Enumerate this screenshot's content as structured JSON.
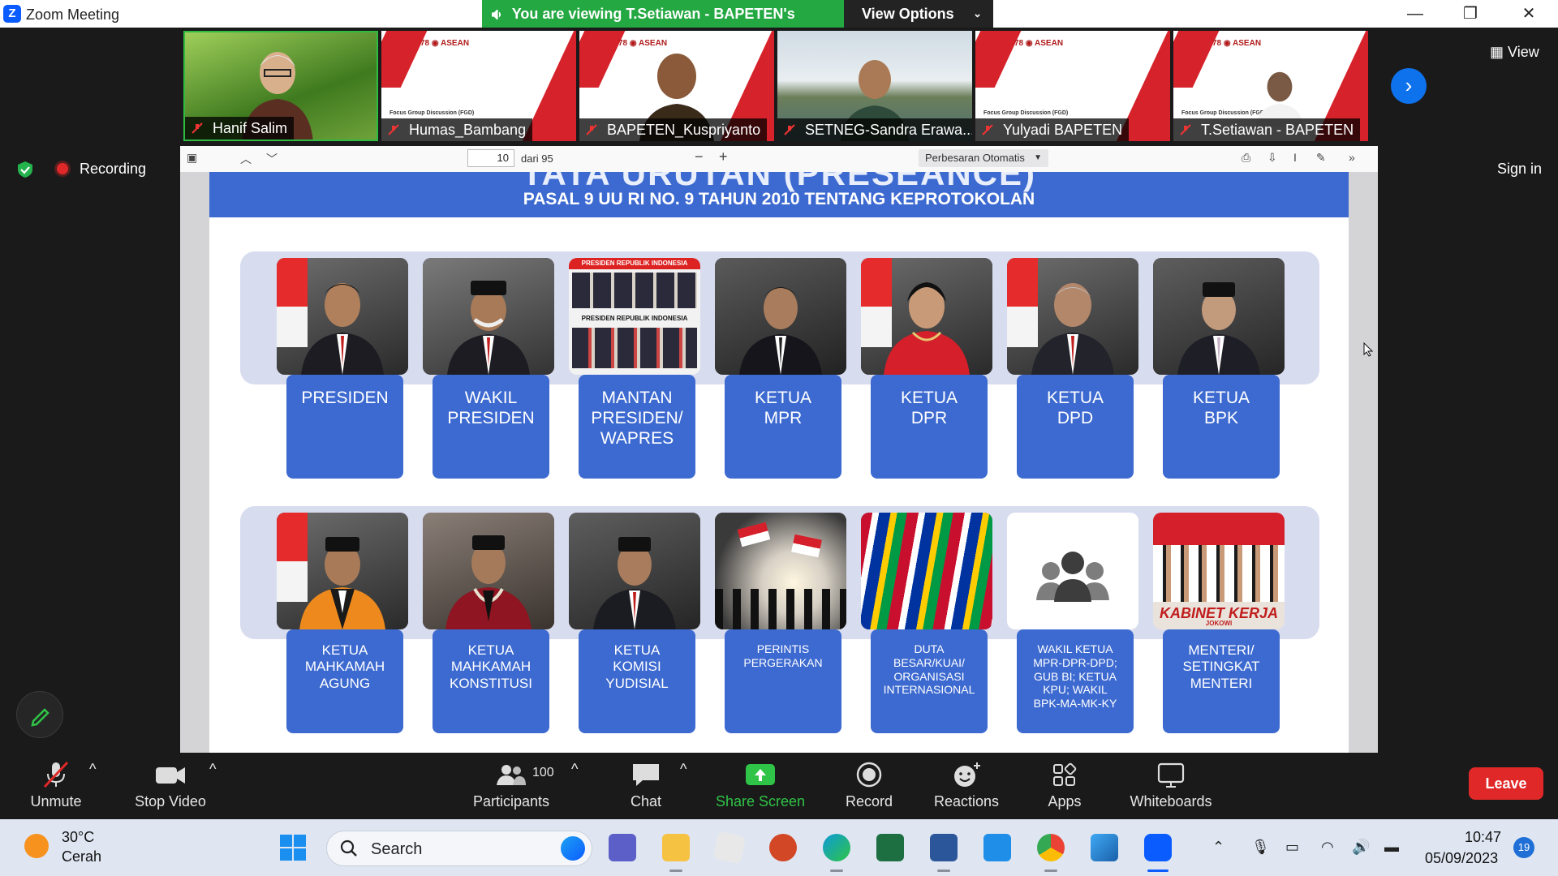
{
  "window": {
    "title": "Zoom Meeting",
    "share_banner": "You are viewing T.Setiawan - BAPETEN's screen",
    "view_options": "View Options",
    "minimize": "—",
    "restore": "❐",
    "close": "✕"
  },
  "meeting": {
    "participants_strip": [
      {
        "name": "Hanif Salim",
        "active": true
      },
      {
        "name": "Humas_Bambang"
      },
      {
        "name": "BAPETEN_Kuspriyanto"
      },
      {
        "name": "SETNEG-Sandra Erawa..."
      },
      {
        "name": "Yulyadi BAPETEN"
      },
      {
        "name": "T.Setiawan - BAPETEN"
      }
    ],
    "tile_fgd": "Focus Group Discussion (FGD)",
    "view_label": "View",
    "sign_in": "Sign in",
    "recording": "Recording"
  },
  "pdf": {
    "page_current": "10",
    "page_total": "dari 95",
    "zoom": "Perbesaran Otomatis"
  },
  "slide": {
    "title_cut": "TATA URUTAN (PRESEANCE)",
    "subtitle": "PASAL 9 UU RI NO. 9 TAHUN 2010 TENTANG KEPROTOKOLAN",
    "row1": [
      {
        "label": "PRESIDEN",
        "size": "big"
      },
      {
        "label": "WAKIL\nPRESIDEN",
        "size": "big"
      },
      {
        "label": "MANTAN\nPRESIDEN/\nWAPRES",
        "size": "big"
      },
      {
        "label": "KETUA\nMPR",
        "size": "big"
      },
      {
        "label": "KETUA\nDPR",
        "size": "big"
      },
      {
        "label": "KETUA\nDPD",
        "size": "big"
      },
      {
        "label": "KETUA\nBPK",
        "size": "big"
      }
    ],
    "row2": [
      {
        "label": "KETUA\nMAHKAMAH\nAGUNG",
        "size": "mid"
      },
      {
        "label": "KETUA\nMAHKAMAH\nKONSTITUSI",
        "size": "mid"
      },
      {
        "label": "KETUA\nKOMISI\nYUDISIAL",
        "size": "mid"
      },
      {
        "label": "PERINTIS\nPERGERAKAN",
        "size": "sm"
      },
      {
        "label": "DUTA\nBESAR/KUAI/\nORGANISASI\nINTERNASIONAL",
        "size": "sm"
      },
      {
        "label": "WAKIL KETUA\nMPR-DPR-DPD;\nGUB BI; KETUA\nKPU; WAKIL\nBPK-MA-MK-KY",
        "size": "sm"
      },
      {
        "label": "MENTERI/\nSETINGKAT\nMENTERI",
        "size": "mid"
      }
    ],
    "photo_text": {
      "mantan_banner": "PRESIDEN REPUBLIK INDONESIA",
      "kabinet": "KABINET KERJA",
      "jokowi": "JOKOWI"
    }
  },
  "controls": {
    "unmute": "Unmute",
    "stop_video": "Stop Video",
    "participants": "Participants",
    "participants_count": "100",
    "chat": "Chat",
    "share_screen": "Share Screen",
    "record": "Record",
    "reactions": "Reactions",
    "apps": "Apps",
    "whiteboards": "Whiteboards",
    "leave": "Leave"
  },
  "taskbar": {
    "temp": "30°C",
    "condition": "Cerah",
    "search": "Search",
    "time": "10:47",
    "date": "05/09/2023",
    "notifications": "19"
  }
}
